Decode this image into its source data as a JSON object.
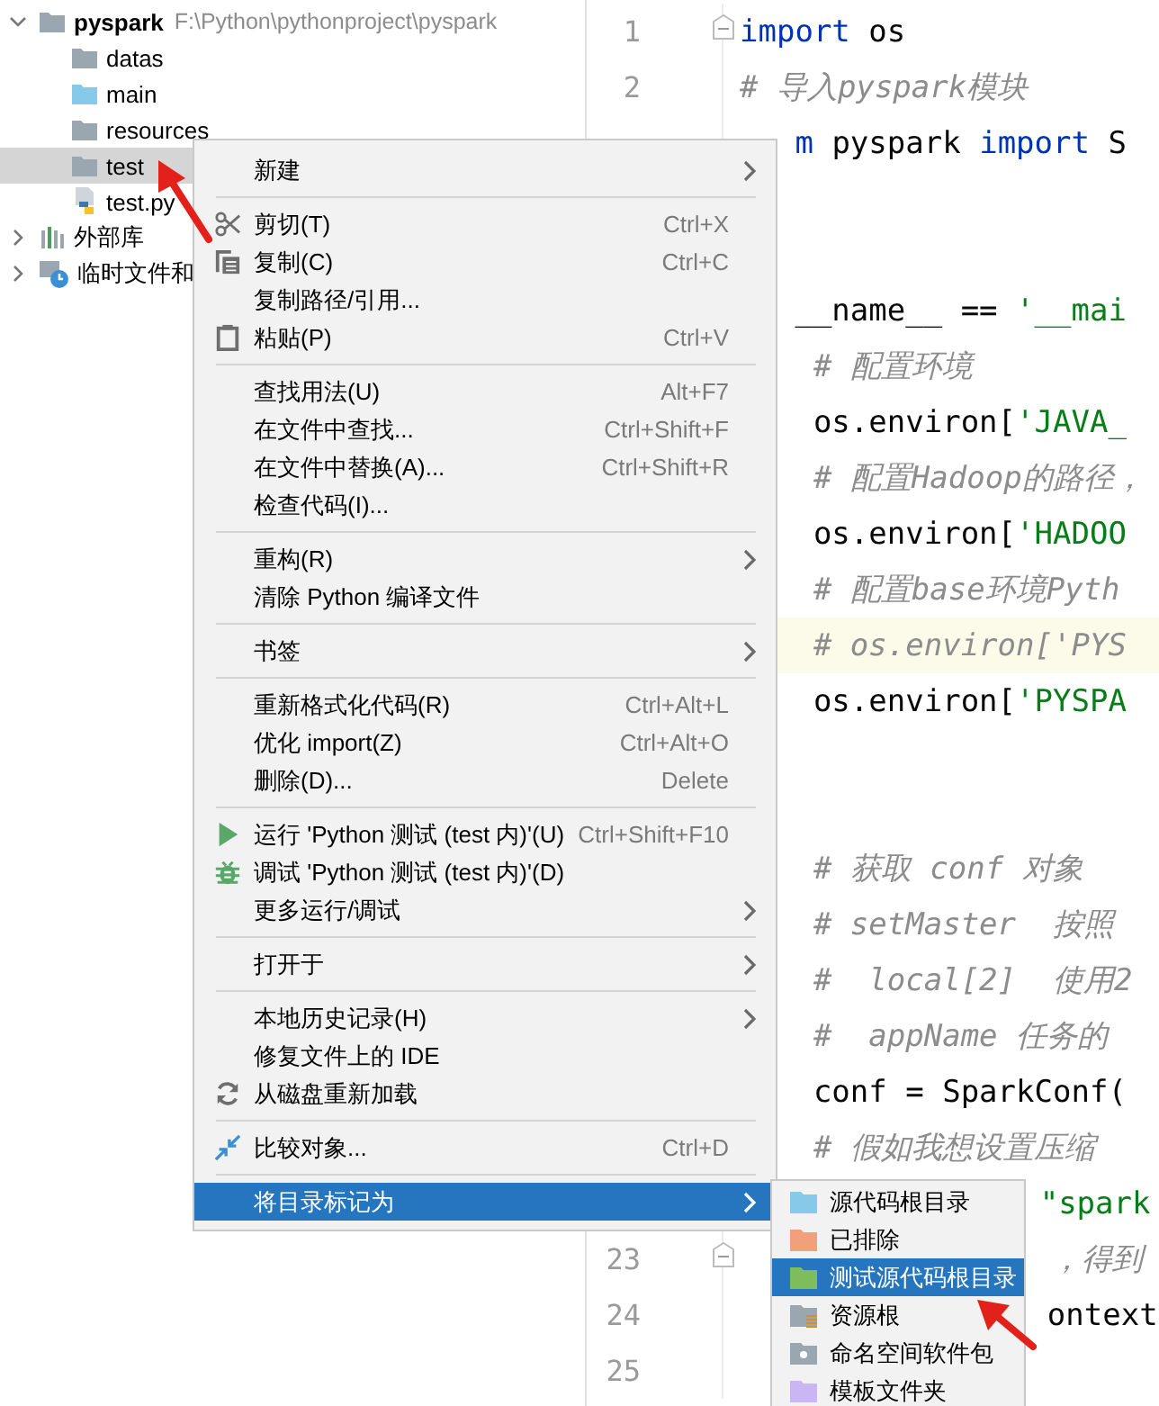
{
  "project_tree": [
    {
      "label": "pyspark",
      "path": "F:\\Python\\pythonproject\\pyspark",
      "kind": "folder",
      "expanded": true,
      "selected": false,
      "children": [
        {
          "label": "datas",
          "kind": "folder",
          "selected": false
        },
        {
          "label": "main",
          "kind": "source-folder",
          "selected": false
        },
        {
          "label": "resources",
          "kind": "folder",
          "selected": false
        },
        {
          "label": "test",
          "kind": "folder",
          "selected": true
        },
        {
          "label": "test.py",
          "kind": "python-file",
          "selected": false
        }
      ]
    },
    {
      "label": "外部库",
      "kind": "library",
      "expanded": false,
      "selected": false
    },
    {
      "label": "临时文件和",
      "kind": "scratch",
      "expanded": false,
      "selected": false
    }
  ],
  "editor": {
    "lines": [
      {
        "number": "1",
        "current": false,
        "segments": [
          {
            "kind": "keyword",
            "text": "import"
          },
          {
            "kind": "plain",
            "text": " os"
          }
        ]
      },
      {
        "number": "2",
        "current": false,
        "segments": [
          {
            "kind": "comment",
            "text": "# 导入pyspark模块"
          }
        ]
      },
      {
        "current": false,
        "segments": [
          {
            "kind": "keyword",
            "text": "m"
          },
          {
            "kind": "plain",
            "text": " pyspark "
          },
          {
            "kind": "keyword",
            "text": "import"
          },
          {
            "kind": "plain",
            "text": " S"
          }
        ]
      },
      {
        "current": false
      },
      {
        "current": false
      },
      {
        "current": false,
        "segments": [
          {
            "kind": "plain",
            "text": "__name__ == "
          },
          {
            "kind": "string",
            "text": "'__mai"
          }
        ]
      },
      {
        "current": false,
        "segments": [
          {
            "kind": "comment",
            "text": "# 配置环境"
          }
        ]
      },
      {
        "current": false,
        "segments": [
          {
            "kind": "plain",
            "text": "os.environ["
          },
          {
            "kind": "string",
            "text": "'JAVA_"
          }
        ]
      },
      {
        "current": false,
        "segments": [
          {
            "kind": "comment",
            "text": "# 配置Hadoop的路径，"
          }
        ]
      },
      {
        "current": false,
        "segments": [
          {
            "kind": "plain",
            "text": "os.environ["
          },
          {
            "kind": "string",
            "text": "'HADOO"
          }
        ]
      },
      {
        "current": false,
        "segments": [
          {
            "kind": "comment",
            "text": "# 配置base环境Pyth"
          }
        ]
      },
      {
        "current": true,
        "segments": [
          {
            "kind": "comment",
            "text": "# os.environ['PYS"
          }
        ]
      },
      {
        "current": false,
        "segments": [
          {
            "kind": "plain",
            "text": "os.environ["
          },
          {
            "kind": "string",
            "text": "'PYSPA"
          }
        ]
      },
      {
        "current": false
      },
      {
        "current": false
      },
      {
        "current": false,
        "segments": [
          {
            "kind": "comment",
            "text": "# 获取 conf 对象"
          }
        ]
      },
      {
        "current": false,
        "segments": [
          {
            "kind": "comment",
            "text": "# setMaster  按照"
          }
        ]
      },
      {
        "current": false,
        "segments": [
          {
            "kind": "comment",
            "text": "#  local[2]  使用2"
          }
        ]
      },
      {
        "current": false,
        "segments": [
          {
            "kind": "comment",
            "text": "#  appName 任务的"
          }
        ]
      },
      {
        "current": false,
        "segments": [
          {
            "kind": "plain",
            "text": "conf = SparkConf("
          }
        ]
      },
      {
        "current": false,
        "segments": [
          {
            "kind": "comment",
            "text": "# 假如我想设置压缩"
          }
        ]
      },
      {
        "current": false,
        "segments": [
          {
            "kind": "string",
            "text": "\"spark"
          }
        ]
      },
      {
        "number": "23",
        "current": false,
        "segments": [
          {
            "kind": "comment",
            "text": "，得到"
          }
        ]
      },
      {
        "number": "24",
        "current": false,
        "segments": [
          {
            "kind": "plain",
            "text": "ontext"
          }
        ]
      },
      {
        "number": "25",
        "current": false
      }
    ]
  },
  "context_menu": [
    {
      "kind": "item",
      "label": "新建",
      "submenu": true,
      "selected": false
    },
    {
      "kind": "separator"
    },
    {
      "kind": "item",
      "label": "剪切(T)",
      "shortcut": "Ctrl+X",
      "submenu": false,
      "selected": false
    },
    {
      "kind": "item",
      "label": "复制(C)",
      "shortcut": "Ctrl+C",
      "submenu": false,
      "selected": false
    },
    {
      "kind": "item",
      "label": "复制路径/引用...",
      "submenu": false,
      "selected": false
    },
    {
      "kind": "item",
      "label": "粘贴(P)",
      "shortcut": "Ctrl+V",
      "submenu": false,
      "selected": false
    },
    {
      "kind": "separator"
    },
    {
      "kind": "item",
      "label": "查找用法(U)",
      "shortcut": "Alt+F7",
      "submenu": false,
      "selected": false
    },
    {
      "kind": "item",
      "label": "在文件中查找...",
      "shortcut": "Ctrl+Shift+F",
      "submenu": false,
      "selected": false
    },
    {
      "kind": "item",
      "label": "在文件中替换(A)...",
      "shortcut": "Ctrl+Shift+R",
      "submenu": false,
      "selected": false
    },
    {
      "kind": "item",
      "label": "检查代码(I)...",
      "submenu": false,
      "selected": false
    },
    {
      "kind": "separator"
    },
    {
      "kind": "item",
      "label": "重构(R)",
      "submenu": true,
      "selected": false
    },
    {
      "kind": "item",
      "label": "清除 Python 编译文件",
      "submenu": false,
      "selected": false
    },
    {
      "kind": "separator"
    },
    {
      "kind": "item",
      "label": "书签",
      "submenu": true,
      "selected": false
    },
    {
      "kind": "separator"
    },
    {
      "kind": "item",
      "label": "重新格式化代码(R)",
      "shortcut": "Ctrl+Alt+L",
      "submenu": false,
      "selected": false
    },
    {
      "kind": "item",
      "label": "优化 import(Z)",
      "shortcut": "Ctrl+Alt+O",
      "submenu": false,
      "selected": false
    },
    {
      "kind": "item",
      "label": "删除(D)...",
      "shortcut": "Delete",
      "submenu": false,
      "selected": false
    },
    {
      "kind": "separator"
    },
    {
      "kind": "item",
      "label": "运行 'Python 测试 (test 内)'(U)",
      "shortcut": "Ctrl+Shift+F10",
      "submenu": false,
      "selected": false
    },
    {
      "kind": "item",
      "label": "调试 'Python 测试 (test 内)'(D)",
      "submenu": false,
      "selected": false
    },
    {
      "kind": "item",
      "label": "更多运行/调试",
      "submenu": true,
      "selected": false
    },
    {
      "kind": "separator"
    },
    {
      "kind": "item",
      "label": "打开于",
      "submenu": true,
      "selected": false
    },
    {
      "kind": "separator"
    },
    {
      "kind": "item",
      "label": "本地历史记录(H)",
      "submenu": true,
      "selected": false
    },
    {
      "kind": "item",
      "label": "修复文件上的 IDE",
      "submenu": false,
      "selected": false
    },
    {
      "kind": "item",
      "label": "从磁盘重新加载",
      "submenu": false,
      "selected": false
    },
    {
      "kind": "separator"
    },
    {
      "kind": "item",
      "label": "比较对象...",
      "shortcut": "Ctrl+D",
      "submenu": false,
      "selected": false
    },
    {
      "kind": "separator"
    },
    {
      "kind": "item",
      "label": "将目录标记为",
      "submenu": true,
      "selected": true
    }
  ],
  "submenu": [
    {
      "label": "源代码根目录",
      "kind": "folder",
      "color": "#87c9e8",
      "selected": false
    },
    {
      "label": "已排除",
      "kind": "folder",
      "color": "#f2a07b",
      "selected": false
    },
    {
      "label": "测试源代码根目录",
      "kind": "folder",
      "color": "#7dbd5e",
      "selected": true
    },
    {
      "label": "资源根",
      "kind": "resource",
      "color": "#9aa7b0",
      "selected": false
    },
    {
      "label": "命名空间软件包",
      "kind": "namespace",
      "color": "#9aa7b0",
      "selected": false
    },
    {
      "label": "模板文件夹",
      "kind": "folder",
      "color": "#c9b6f2",
      "selected": false
    }
  ]
}
